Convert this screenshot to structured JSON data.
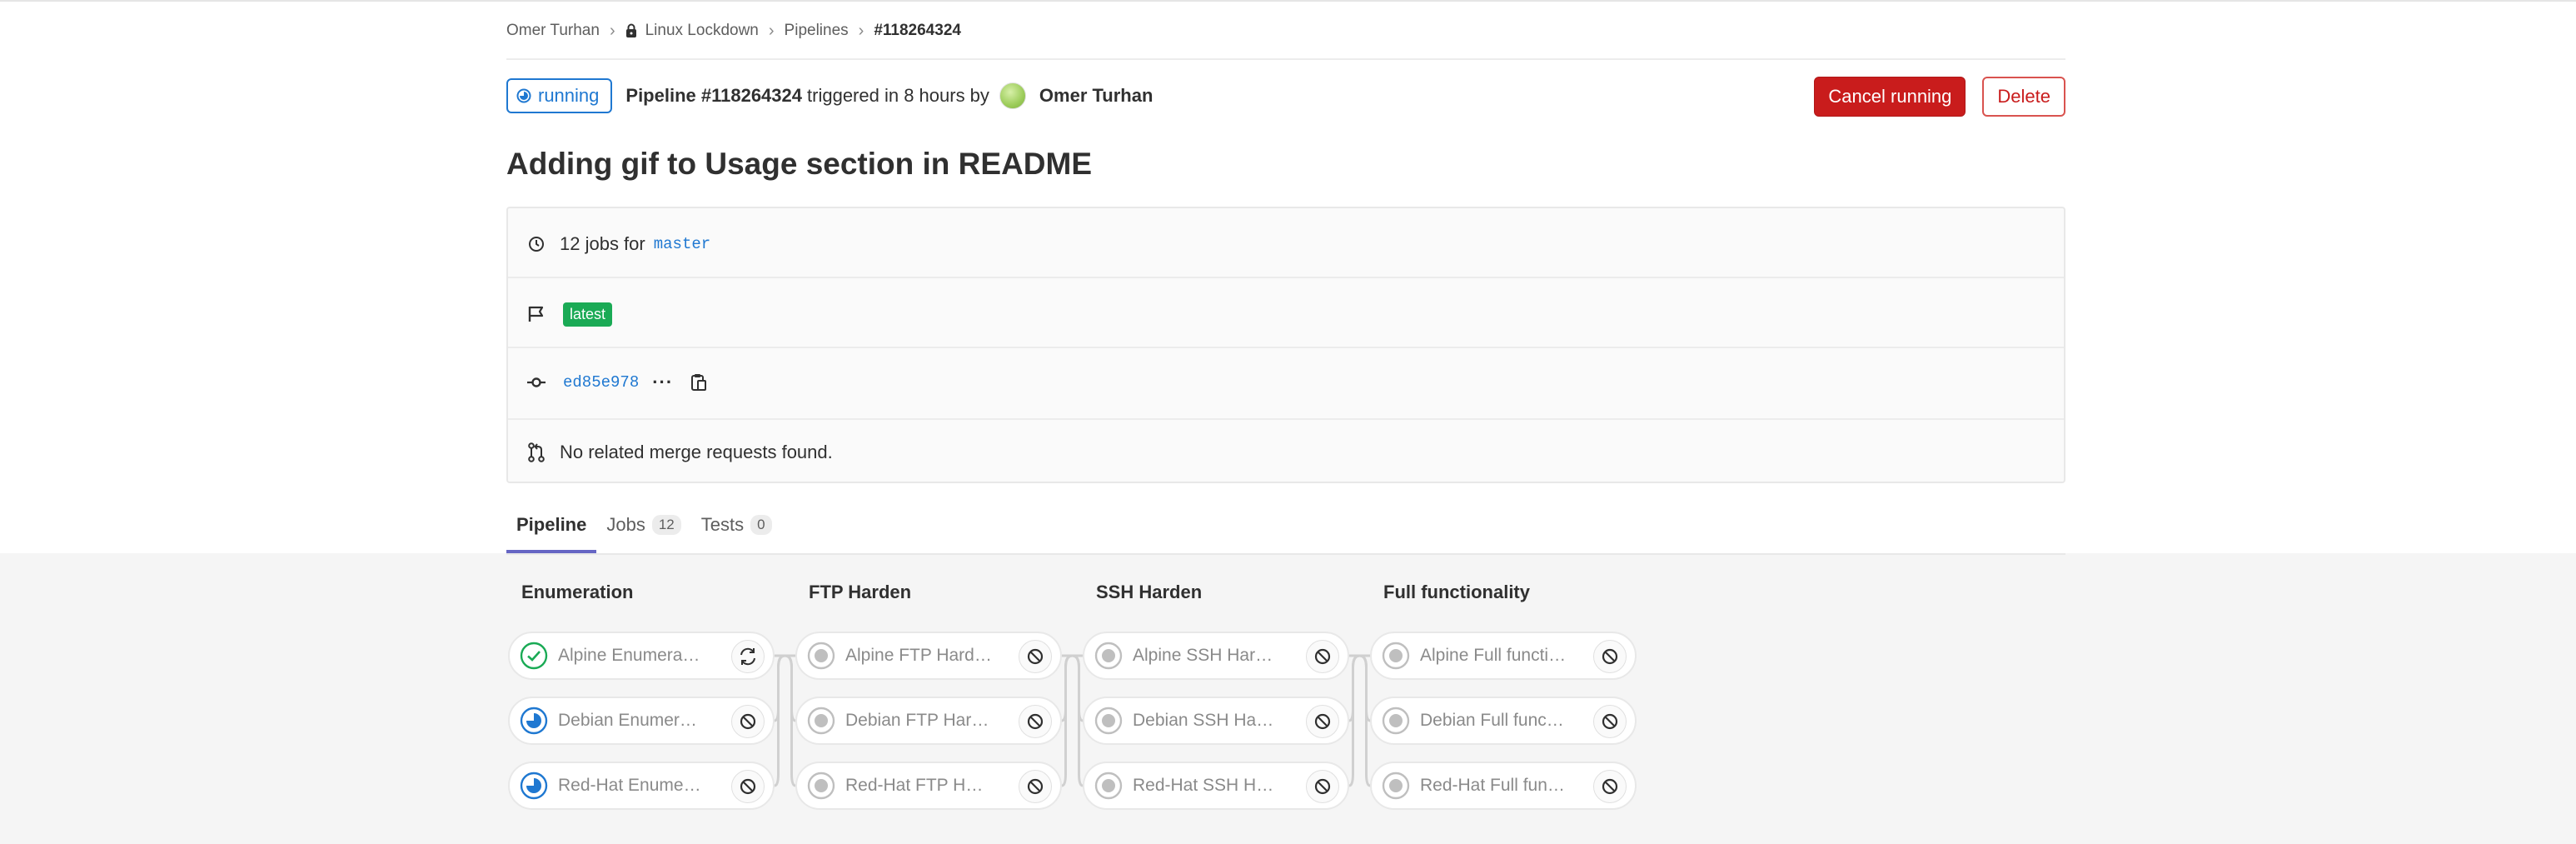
{
  "breadcrumb": {
    "items": [
      "Omer Turhan",
      "Linux Lockdown",
      "Pipelines"
    ],
    "current": "#118264324"
  },
  "header": {
    "status": "running",
    "pipeline_label": "Pipeline #118264324",
    "triggered_text": "triggered in 8 hours by",
    "user": "Omer Turhan",
    "cancel_label": "Cancel running",
    "delete_label": "Delete"
  },
  "title": "Adding gif to Usage section in README",
  "info": {
    "jobs_text": "12 jobs for",
    "branch": "master",
    "latest_badge": "latest",
    "sha": "ed85e978",
    "ellipsis": "···",
    "merge_text": "No related merge requests found."
  },
  "tabs": [
    {
      "label": "Pipeline",
      "count": null
    },
    {
      "label": "Jobs",
      "count": "12"
    },
    {
      "label": "Tests",
      "count": "0"
    }
  ],
  "stages": [
    {
      "name": "Enumeration",
      "jobs": [
        {
          "name": "Alpine Enumeration",
          "status": "success",
          "action": "retry-icon"
        },
        {
          "name": "Debian Enumeration",
          "status": "running",
          "action": "cancel-icon"
        },
        {
          "name": "Red-Hat Enumeration",
          "status": "running",
          "action": "cancel-icon"
        }
      ]
    },
    {
      "name": "FTP Harden",
      "jobs": [
        {
          "name": "Alpine FTP Harden",
          "status": "created",
          "action": "cancel-icon"
        },
        {
          "name": "Debian FTP Harden",
          "status": "created",
          "action": "cancel-icon"
        },
        {
          "name": "Red-Hat FTP Harden",
          "status": "created",
          "action": "cancel-icon"
        }
      ]
    },
    {
      "name": "SSH Harden",
      "jobs": [
        {
          "name": "Alpine SSH Harden",
          "status": "created",
          "action": "cancel-icon"
        },
        {
          "name": "Debian SSH Harden",
          "status": "created",
          "action": "cancel-icon"
        },
        {
          "name": "Red-Hat SSH Harden",
          "status": "created",
          "action": "cancel-icon"
        }
      ]
    },
    {
      "name": "Full functionality",
      "jobs": [
        {
          "name": "Alpine Full functionality",
          "status": "created",
          "action": "cancel-icon"
        },
        {
          "name": "Debian Full functionality",
          "status": "created",
          "action": "cancel-icon"
        },
        {
          "name": "Red-Hat Full functionality",
          "status": "created",
          "action": "cancel-icon"
        }
      ]
    }
  ],
  "colors": {
    "success": "#1aaa55",
    "running": "#1f78d1",
    "created": "#bfbfbf",
    "danger": "#c91c1c",
    "tab_active": "#6666c4"
  }
}
